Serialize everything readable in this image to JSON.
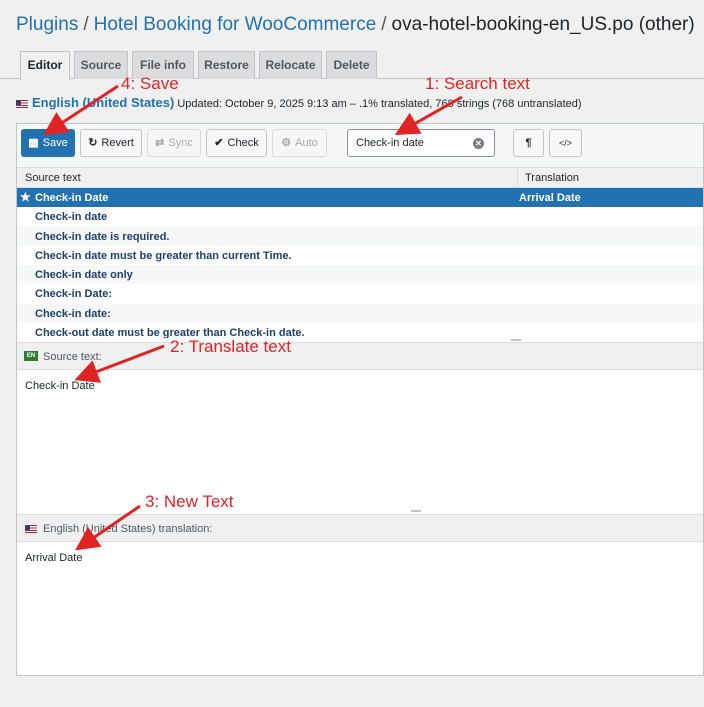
{
  "breadcrumb": {
    "plugins": "Plugins",
    "plugin": "Hotel Booking for WooCommerce",
    "file": "ova-hotel-booking-en_US.po (other)",
    "separator": "/"
  },
  "tabs": [
    "Editor",
    "Source",
    "File info",
    "Restore",
    "Relocate",
    "Delete"
  ],
  "meta": {
    "language": "English (United States)",
    "status": "Updated: October 9, 2025 9:13 am – .1% translated, 768 strings (768 untranslated)"
  },
  "toolbar": {
    "save": "Save",
    "revert": "Revert",
    "sync": "Sync",
    "check": "Check",
    "auto": "Auto",
    "search_value": "Check-in date",
    "pilcrow": "¶",
    "code": "</>"
  },
  "list": {
    "col_source": "Source text",
    "col_translation": "Translation",
    "rows": [
      {
        "source": "Check-in Date",
        "translation": "Arrival Date"
      },
      {
        "source": "Check-in date",
        "translation": ""
      },
      {
        "source": "Check-in date is required.",
        "translation": ""
      },
      {
        "source": "Check-in date must be greater than current Time.",
        "translation": ""
      },
      {
        "source": "Check-in date only",
        "translation": ""
      },
      {
        "source": "Check-in Date:",
        "translation": ""
      },
      {
        "source": "Check-in date:",
        "translation": ""
      },
      {
        "source": "Check-out date must be greater than Check-in date.",
        "translation": ""
      }
    ]
  },
  "source_panel": {
    "badge": "EN",
    "label": "Source text:",
    "text": "Check-in Date"
  },
  "translation_panel": {
    "label": "English (United States) translation:",
    "text": "Arrival Date"
  },
  "annotations": {
    "search": "1: Search text",
    "translate": "2: Translate text",
    "new_text": "3: New Text",
    "save": "4: Save"
  },
  "colors": {
    "accent": "#2271b1",
    "annotation": "#e02424",
    "background": "#f0f0f1"
  }
}
